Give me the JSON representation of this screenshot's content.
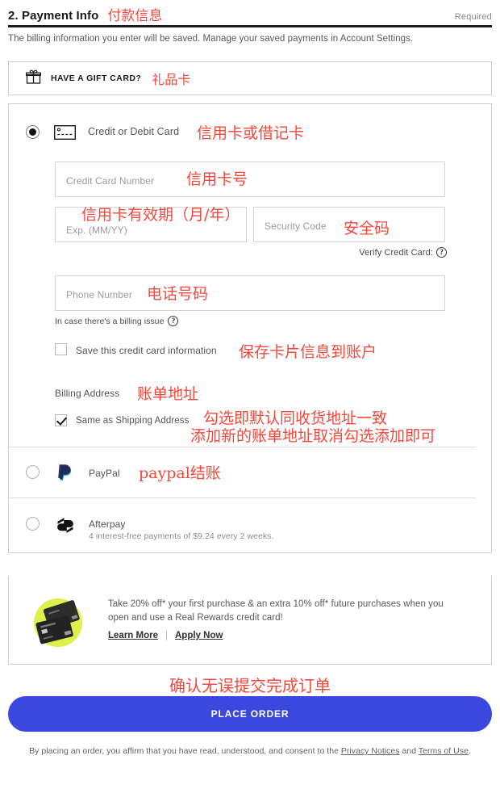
{
  "header": {
    "title": "2. Payment Info",
    "title_annotation": "付款信息",
    "required_label": "Required",
    "note": "The billing information you enter will be saved. Manage your saved payments in Account Settings."
  },
  "gift_card": {
    "icon": "gift-icon",
    "label": "HAVE A GIFT CARD?",
    "annotation": "礼品卡"
  },
  "payment_methods": {
    "credit_card": {
      "icon": "credit-card-icon",
      "label": "Credit or Debit Card",
      "annotation": "信用卡或借记卡",
      "selected": true,
      "fields": {
        "card_number": {
          "placeholder": "Credit Card Number",
          "value": "",
          "annotation": "信用卡号"
        },
        "expiration": {
          "placeholder": "Exp. (MM/YY)",
          "value": "",
          "annotation": "信用卡有效期（月/年）"
        },
        "security_code": {
          "placeholder": "Security Code",
          "value": "",
          "annotation": "安全码"
        },
        "phone": {
          "placeholder": "Phone Number",
          "value": "",
          "annotation": "电话号码"
        }
      },
      "verify_label": "Verify Credit Card:",
      "verify_help_icon": "question-mark-icon",
      "billing_issue_note": "In case there's a billing issue",
      "billing_issue_help_icon": "question-mark-icon",
      "save_card": {
        "label": "Save this credit card information",
        "checked": false,
        "annotation": "保存卡片信息到账户"
      },
      "billing_address_label": "Billing Address",
      "billing_address_annotation": "账单地址",
      "same_as_shipping": {
        "label": "Same as Shipping Address",
        "checked": true
      },
      "same_as_shipping_annotation_line1": "勾选即默认同收货地址一致",
      "same_as_shipping_annotation_line2": "添加新的账单地址取消勾选添加即可"
    },
    "paypal": {
      "icon": "paypal-icon",
      "label": "PayPal",
      "annotation": "paypal结账",
      "selected": false
    },
    "afterpay": {
      "icon": "afterpay-icon",
      "label": "Afterpay",
      "description": "4 interest-free payments of $9.24 every 2 weeks.",
      "selected": false
    }
  },
  "promo": {
    "image": "credit-cards-illustration",
    "text": "Take 20% off* your first purchase & an extra 10% off* future purchases when you open and use a Real Rewards credit card!",
    "learn_more": "Learn More",
    "separator": "|",
    "apply_now": "Apply Now"
  },
  "place_order": {
    "annotation": "确认无误提交完成订单",
    "label": "PLACE ORDER",
    "color": "#3a48e0"
  },
  "legal": {
    "text_part1": "By placing an order, you affirm that you have read, understood, and consent to the ",
    "privacy_link": "Privacy Notices",
    "text_part2": " and ",
    "terms_link": "Terms of Use",
    "text_part3": "."
  },
  "colors": {
    "annotation_red": "#f4483c",
    "accent_blue": "#3a48e0",
    "promo_circle": "#dcf24a"
  }
}
